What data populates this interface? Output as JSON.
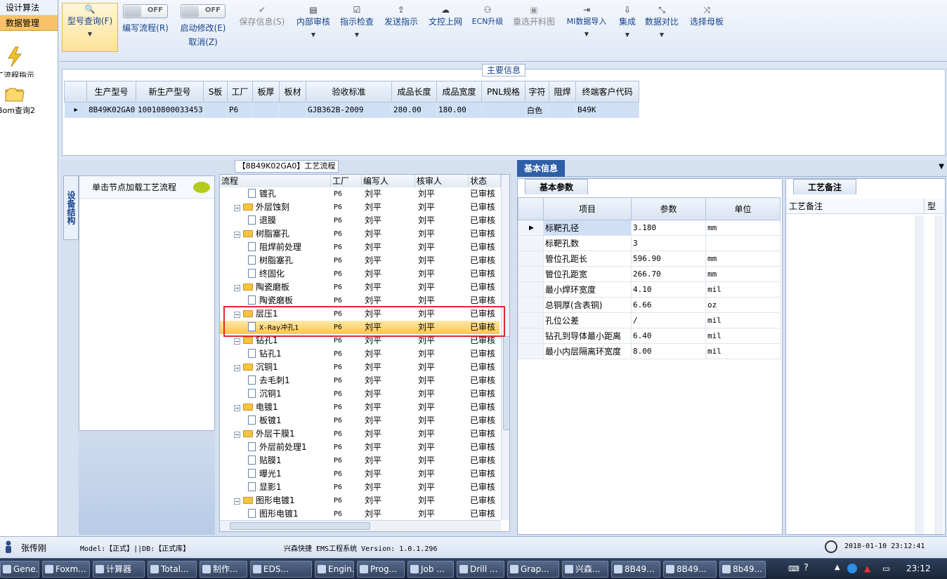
{
  "nav": {
    "tabs": [
      "设计算法",
      "数据管理"
    ],
    "items": [
      "工流程指示",
      "Bom查询2"
    ]
  },
  "toolbar": {
    "buttons": [
      {
        "label": "型号查询(F)",
        "icon": "search-icon"
      },
      {
        "label": "编写流程(R)",
        "toggle": "OFF"
      },
      {
        "label": "启动修改(E)",
        "label2": "取消(Z)",
        "toggle": "OFF"
      },
      {
        "label": "保存信息(S)",
        "icon": "check-icon",
        "disabled": true
      },
      {
        "label": "内部审核",
        "icon": "print-icon"
      },
      {
        "label": "指示检查",
        "icon": "checkbox-icon"
      },
      {
        "label": "发送指示",
        "icon": "upload-icon"
      },
      {
        "label": "文控上网",
        "icon": "cloud-icon"
      },
      {
        "label": "ECN升级",
        "icon": "binoculars-icon"
      },
      {
        "label": "重选开料图",
        "icon": "image-icon",
        "disabled": true
      },
      {
        "label": "MI数据导入",
        "icon": "import-icon"
      },
      {
        "label": "集成",
        "icon": "download-icon"
      },
      {
        "label": "数据对比",
        "icon": "compress-icon"
      },
      {
        "label": "选择母板",
        "icon": "shuffle-icon"
      }
    ]
  },
  "main_info": {
    "title": "主要信息",
    "columns": [
      "生产型号",
      "新生产型号",
      "S板",
      "工厂",
      "板厚",
      "板材",
      "验收标准",
      "成品长度",
      "成品宽度",
      "PNL规格",
      "字符",
      "阻焊",
      "终端客户代码"
    ],
    "row": [
      "8B49K02GA0",
      "10010800033453",
      "",
      "P6",
      "",
      "",
      "GJB362B-2009",
      "280.00",
      "180.00",
      "",
      "白色",
      "",
      "B49K"
    ]
  },
  "side": {
    "tab": "设备结构",
    "hint": "单击节点加载工艺流程"
  },
  "flow": {
    "title": "【8B49K02GA0】工艺流程",
    "columns": [
      "流程",
      "工厂",
      "编写人",
      "核审人",
      "状态"
    ],
    "rows": [
      {
        "name": "镀孔",
        "level": 2,
        "factory": "P6",
        "writer": "刘平",
        "reviewer": "刘平",
        "status": "已审核"
      },
      {
        "name": "外层蚀刻",
        "level": 1,
        "factory": "P6",
        "writer": "刘平",
        "reviewer": "刘平",
        "status": "已审核"
      },
      {
        "name": "退膜",
        "level": 2,
        "factory": "P6",
        "writer": "刘平",
        "reviewer": "刘平",
        "status": "已审核"
      },
      {
        "name": "树脂塞孔",
        "level": 1,
        "factory": "P6",
        "writer": "刘平",
        "reviewer": "刘平",
        "status": "已审核"
      },
      {
        "name": "阻焊前处理",
        "level": 2,
        "factory": "P6",
        "writer": "刘平",
        "reviewer": "刘平",
        "status": "已审核"
      },
      {
        "name": "树脂塞孔",
        "level": 2,
        "factory": "P6",
        "writer": "刘平",
        "reviewer": "刘平",
        "status": "已审核"
      },
      {
        "name": "终固化",
        "level": 2,
        "factory": "P6",
        "writer": "刘平",
        "reviewer": "刘平",
        "status": "已审核"
      },
      {
        "name": "陶瓷磨板",
        "level": 1,
        "factory": "P6",
        "writer": "刘平",
        "reviewer": "刘平",
        "status": "已审核"
      },
      {
        "name": "陶瓷磨板",
        "level": 2,
        "factory": "P6",
        "writer": "刘平",
        "reviewer": "刘平",
        "status": "已审核"
      },
      {
        "name": "层压1",
        "level": 1,
        "factory": "P6",
        "writer": "刘平",
        "reviewer": "刘平",
        "status": "已审核"
      },
      {
        "name": "X-Ray冲孔1",
        "level": 2,
        "factory": "P6",
        "writer": "刘平",
        "reviewer": "刘平",
        "status": "已审核",
        "selected": true
      },
      {
        "name": "钻孔1",
        "level": 1,
        "factory": "P6",
        "writer": "刘平",
        "reviewer": "刘平",
        "status": "已审核"
      },
      {
        "name": "钻孔1",
        "level": 2,
        "factory": "P6",
        "writer": "刘平",
        "reviewer": "刘平",
        "status": "已审核"
      },
      {
        "name": "沉铜1",
        "level": 1,
        "factory": "P6",
        "writer": "刘平",
        "reviewer": "刘平",
        "status": "已审核"
      },
      {
        "name": "去毛刺1",
        "level": 2,
        "factory": "P6",
        "writer": "刘平",
        "reviewer": "刘平",
        "status": "已审核"
      },
      {
        "name": "沉铜1",
        "level": 2,
        "factory": "P6",
        "writer": "刘平",
        "reviewer": "刘平",
        "status": "已审核"
      },
      {
        "name": "电镀1",
        "level": 1,
        "factory": "P6",
        "writer": "刘平",
        "reviewer": "刘平",
        "status": "已审核"
      },
      {
        "name": "板镀1",
        "level": 2,
        "factory": "P6",
        "writer": "刘平",
        "reviewer": "刘平",
        "status": "已审核"
      },
      {
        "name": "外层干膜1",
        "level": 1,
        "factory": "P6",
        "writer": "刘平",
        "reviewer": "刘平",
        "status": "已审核"
      },
      {
        "name": "外层前处理1",
        "level": 2,
        "factory": "P6",
        "writer": "刘平",
        "reviewer": "刘平",
        "status": "已审核"
      },
      {
        "name": "贴膜1",
        "level": 2,
        "factory": "P6",
        "writer": "刘平",
        "reviewer": "刘平",
        "status": "已审核"
      },
      {
        "name": "曝光1",
        "level": 2,
        "factory": "P6",
        "writer": "刘平",
        "reviewer": "刘平",
        "status": "已审核"
      },
      {
        "name": "显影1",
        "level": 2,
        "factory": "P6",
        "writer": "刘平",
        "reviewer": "刘平",
        "status": "已审核"
      },
      {
        "name": "图形电镀1",
        "level": 1,
        "factory": "P6",
        "writer": "刘平",
        "reviewer": "刘平",
        "status": "已审核"
      },
      {
        "name": "图形电镀1",
        "level": 2,
        "factory": "P6",
        "writer": "刘平",
        "reviewer": "刘平",
        "status": "已审核"
      }
    ]
  },
  "basic": {
    "tab": "基本信息",
    "subtab": "基本参数",
    "columns": [
      "项目",
      "参数",
      "单位"
    ],
    "rows": [
      [
        "标靶孔径",
        "3.180",
        "mm"
      ],
      [
        "标靶孔数",
        "3",
        ""
      ],
      [
        "管位孔距长",
        "596.90",
        "mm"
      ],
      [
        "管位孔距宽",
        "266.70",
        "mm"
      ],
      [
        "最小焊环宽度",
        "4.10",
        "mil"
      ],
      [
        "总铜厚(含表铜)",
        "6.66",
        "oz"
      ],
      [
        "孔位公差",
        "/",
        "mil"
      ],
      [
        "钻孔到导体最小距离",
        "6.40",
        "mil"
      ],
      [
        "最小内层隔离环宽度",
        "8.00",
        "mil"
      ]
    ]
  },
  "notes": {
    "tab": "工艺备注",
    "columns": [
      "工艺备注",
      "型"
    ]
  },
  "status": {
    "user": "张传刚",
    "model": "Model:【正式】||DB:【正式库】",
    "system": "兴森快捷 EMS工程系统 Version: 1.0.1.296",
    "datetime": "2018-01-10 23:12:41"
  },
  "taskbar": {
    "items": [
      "Gene...",
      "Foxm...",
      "计算器",
      "Total...",
      "制作...",
      "EDS...",
      "Engin...",
      "Prog...",
      "Job ...",
      "Drill ...",
      "Grap...",
      "兴森...",
      "8B49...",
      "8B49...",
      "8b49..."
    ],
    "clock": "23:12"
  },
  "colors": {
    "accent": "#2e5fa8",
    "highlight": "#f8c851",
    "frame": "#e02a2a"
  }
}
